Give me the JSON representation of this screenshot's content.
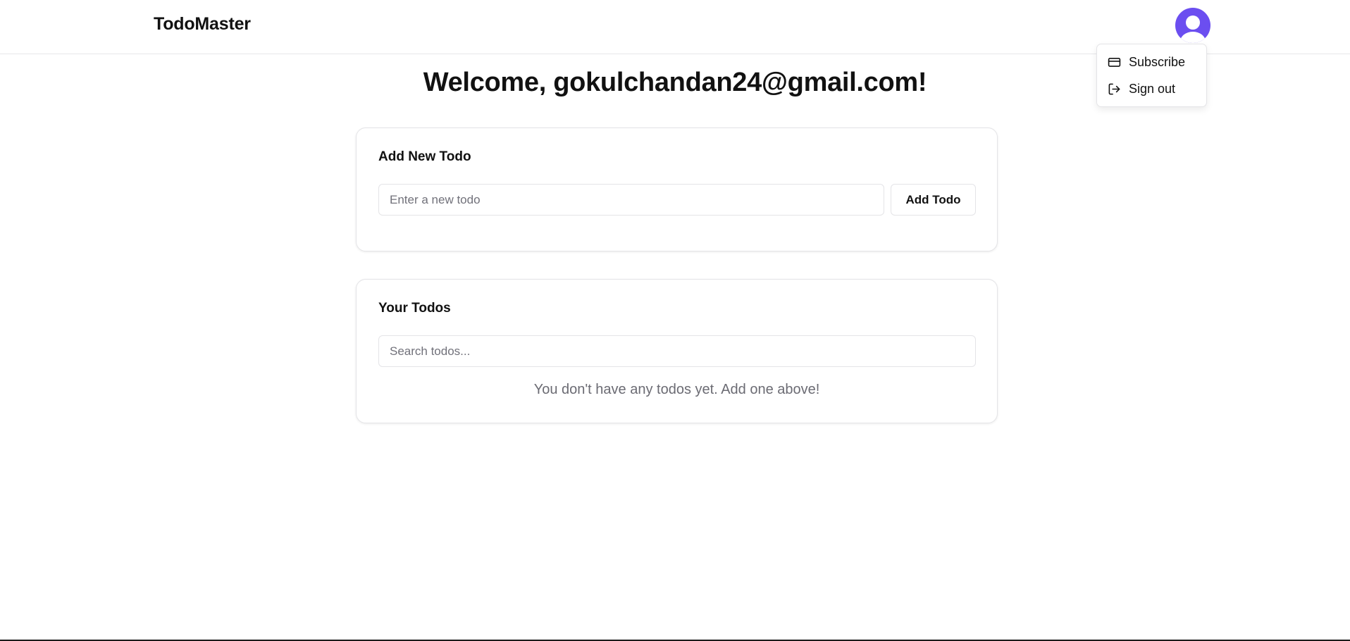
{
  "app": {
    "brand": "TodoMaster",
    "accent_color": "#6b4ef0"
  },
  "header": {
    "avatar_icon": "user-avatar-icon"
  },
  "user_menu": {
    "items": [
      {
        "label": "Subscribe",
        "icon": "credit-card-icon"
      },
      {
        "label": "Sign out",
        "icon": "log-out-icon"
      }
    ]
  },
  "welcome": {
    "text": "Welcome, gokulchandan24@gmail.com!"
  },
  "add_todo": {
    "title": "Add New Todo",
    "input_value": "",
    "input_placeholder": "Enter a new todo",
    "button_label": "Add Todo"
  },
  "todo_list": {
    "title": "Your Todos",
    "search_value": "",
    "search_placeholder": "Search todos...",
    "empty_message": "You don't have any todos yet. Add one above!",
    "items": []
  }
}
